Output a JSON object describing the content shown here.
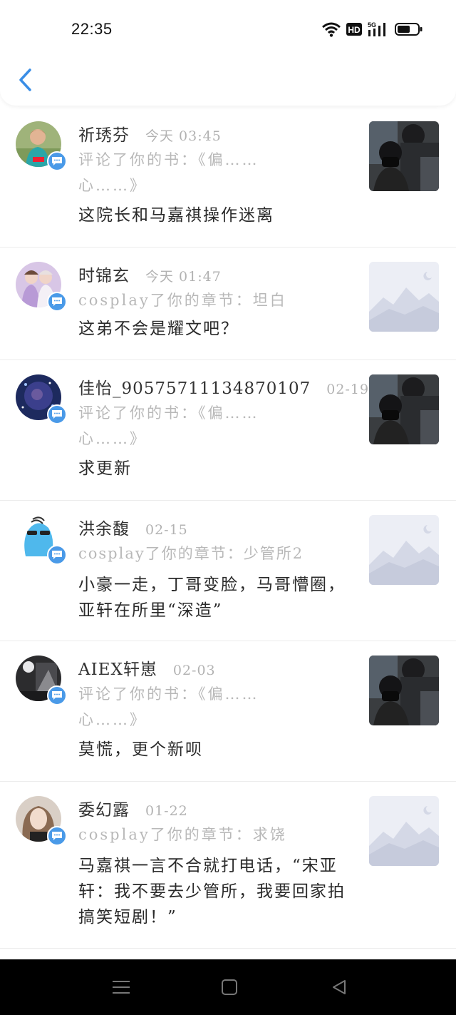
{
  "status_bar": {
    "time": "22:35",
    "icons": [
      "wifi-icon",
      "hd-icon",
      "5g-signal-icon",
      "battery-icon"
    ],
    "network_label": "5G",
    "hd_label": "HD"
  },
  "header": {
    "back_icon": "chevron-left-icon",
    "accent_color": "#3a8ee6"
  },
  "items": [
    {
      "name": "祈琇芬",
      "time": "今天 03:45",
      "action": "评论了你的书：《偏……心……》",
      "content": "这院长和马嘉祺操作迷离",
      "thumb": "photo"
    },
    {
      "name": "时锦玄",
      "time": "今天 01:47",
      "action": "cosplay了你的章节：坦白",
      "content": "这弟不会是耀文吧？",
      "thumb": "placeholder"
    },
    {
      "name": "佳怡_90575711134870107",
      "time": "02-19",
      "action": "评论了你的书：《偏……心……》",
      "content": "求更新",
      "thumb": "photo"
    },
    {
      "name": "洪余馥",
      "time": "02-15",
      "action": "cosplay了你的章节：少管所2",
      "content": "小豪一走，丁哥变脸，马哥懵圈，亚轩在所里“深造”",
      "thumb": "placeholder"
    },
    {
      "name": "AIEX轩崽",
      "time": "02-03",
      "action": "评论了你的书：《偏……心……》",
      "content": "莫慌，更个新呗",
      "thumb": "photo"
    },
    {
      "name": "委幻露",
      "time": "01-22",
      "action": "cosplay了你的章节：求饶",
      "content": "马嘉祺一言不合就打电话，“宋亚轩：我不要去少管所，我要回家拍搞笑短剧！”",
      "thumb": "placeholder"
    }
  ],
  "nav": {
    "menu_icon": "menu-icon",
    "home_icon": "home-icon",
    "back_icon": "back-triangle-icon"
  }
}
